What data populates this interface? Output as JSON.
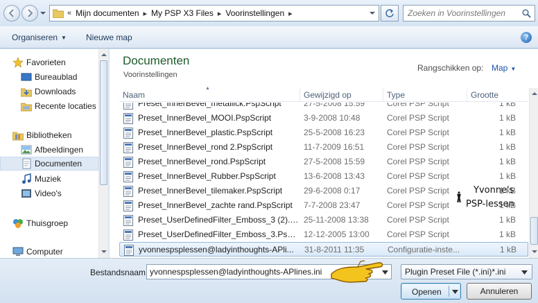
{
  "address": {
    "overflow": "«",
    "crumbs": [
      "Mijn documenten",
      "My PSP X3 Files",
      "Voorinstellingen"
    ],
    "search_placeholder": "Zoeken in Voorinstellingen"
  },
  "toolbar": {
    "organise_label": "Organiseren",
    "new_folder_label": "Nieuwe map",
    "help_glyph": "?"
  },
  "sidebar": {
    "items": [
      {
        "label": "Favorieten",
        "icon": "star-icon",
        "selected": false
      },
      {
        "label": "Bureaublad",
        "icon": "desktop-icon",
        "selected": false
      },
      {
        "label": "Downloads",
        "icon": "downloads-icon",
        "selected": false
      },
      {
        "label": "Recente locaties",
        "icon": "recent-places-icon",
        "selected": false
      },
      {
        "label": "Bibliotheken",
        "icon": "libraries-icon",
        "selected": false
      },
      {
        "label": "Afbeeldingen",
        "icon": "pictures-icon",
        "selected": false
      },
      {
        "label": "Documenten",
        "icon": "documents-icon",
        "selected": true
      },
      {
        "label": "Muziek",
        "icon": "music-icon",
        "selected": false
      },
      {
        "label": "Video's",
        "icon": "videos-icon",
        "selected": false
      },
      {
        "label": "Thuisgroep",
        "icon": "homegroup-icon",
        "selected": false
      },
      {
        "label": "Computer",
        "icon": "computer-icon",
        "selected": false
      }
    ]
  },
  "main": {
    "library_title": "Documenten",
    "library_subtitle": "Voorinstellingen",
    "arrange_label": "Rangschikken op:",
    "arrange_value": "Map",
    "columns": {
      "name": "Naam",
      "date": "Gewijzigd op",
      "type": "Type",
      "size": "Grootte"
    },
    "rows": [
      {
        "name": "Preset_InnerBevel_metallick.PspScript",
        "date": "27-5-2008 15:59",
        "type": "Corel PSP Script",
        "size": "1 kB",
        "selected": false
      },
      {
        "name": "Preset_InnerBevel_MOOI.PspScript",
        "date": "3-9-2008 10:48",
        "type": "Corel PSP Script",
        "size": "1 kB",
        "selected": false
      },
      {
        "name": "Preset_InnerBevel_plastic.PspScript",
        "date": "25-5-2008 16:23",
        "type": "Corel PSP Script",
        "size": "1 kB",
        "selected": false
      },
      {
        "name": "Preset_InnerBevel_rond 2.PspScript",
        "date": "11-7-2009 16:51",
        "type": "Corel PSP Script",
        "size": "1 kB",
        "selected": false
      },
      {
        "name": "Preset_InnerBevel_rond.PspScript",
        "date": "27-5-2008 15:59",
        "type": "Corel PSP Script",
        "size": "1 kB",
        "selected": false
      },
      {
        "name": "Preset_InnerBevel_Rubber.PspScript",
        "date": "13-6-2008 13:43",
        "type": "Corel PSP Script",
        "size": "1 kB",
        "selected": false
      },
      {
        "name": "Preset_InnerBevel_tilemaker.PspScript",
        "date": "29-6-2008 0:17",
        "type": "Corel PSP Script",
        "size": "1 kB",
        "selected": false
      },
      {
        "name": "Preset_InnerBevel_zachte rand.PspScript",
        "date": "7-7-2008 23:47",
        "type": "Corel PSP Script",
        "size": "1 kB",
        "selected": false
      },
      {
        "name": "Preset_UserDefinedFilter_Emboss_3 (2).PspS...",
        "date": "25-11-2008 13:38",
        "type": "Corel PSP Script",
        "size": "1 kB",
        "selected": false
      },
      {
        "name": "Preset_UserDefinedFilter_Emboss_3.PspS...",
        "date": "12-12-2005 13:00",
        "type": "Corel PSP Script",
        "size": "1 kB",
        "selected": false
      },
      {
        "name": "yvonnespsplessen@ladyinthoughts-APli...",
        "date": "31-8-2011 11:35",
        "type": "Configuratie-inste...",
        "size": "1 kB",
        "selected": true
      }
    ],
    "watermark_line1": "Yvonne's",
    "watermark_line2": "PSP-lessen"
  },
  "footer": {
    "filename_label": "Bestandsnaam:",
    "filename_value": "yvonnespsplessen@ladyinthoughts-APlines.ini",
    "filter_value": "Plugin Preset File (*.ini)*.ini",
    "open_label": "Openen",
    "cancel_label": "Annuleren"
  },
  "colors": {
    "library_title": "#1e5a2a",
    "link_blue": "#1a55a8",
    "selection": "#dbe9f8"
  }
}
